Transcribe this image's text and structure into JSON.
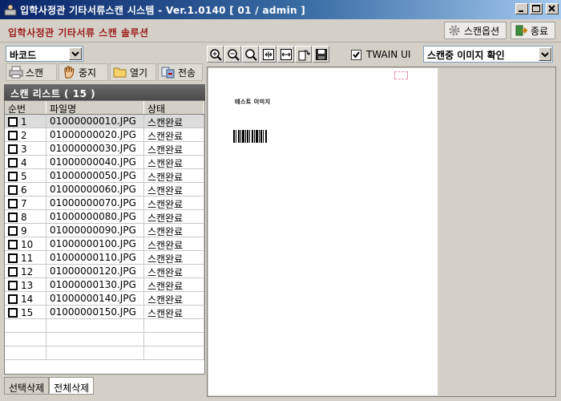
{
  "window": {
    "title": "입학사정관 기타서류스캔 시스템 - Ver.1.0140   [ 01 / admin ]"
  },
  "header": {
    "brand": "입학사정관 기타서류 스캔 솔루션",
    "options_label": "스캔옵션",
    "exit_label": "종료"
  },
  "left": {
    "barcode_select": "바코드",
    "buttons": {
      "scan": "스캔",
      "stop": "중지",
      "open": "열기",
      "send": "전송"
    },
    "list_title": "스캔 리스트 ( 15 )",
    "columns": [
      "순번",
      "파일명",
      "상태"
    ],
    "rows": [
      {
        "no": "1",
        "file": "01000000010.JPG",
        "status": "스캔완료"
      },
      {
        "no": "2",
        "file": "01000000020.JPG",
        "status": "스캔완료"
      },
      {
        "no": "3",
        "file": "01000000030.JPG",
        "status": "스캔완료"
      },
      {
        "no": "4",
        "file": "01000000040.JPG",
        "status": "스캔완료"
      },
      {
        "no": "5",
        "file": "01000000050.JPG",
        "status": "스캔완료"
      },
      {
        "no": "6",
        "file": "01000000060.JPG",
        "status": "스캔완료"
      },
      {
        "no": "7",
        "file": "01000000070.JPG",
        "status": "스캔완료"
      },
      {
        "no": "8",
        "file": "01000000080.JPG",
        "status": "스캔완료"
      },
      {
        "no": "9",
        "file": "01000000090.JPG",
        "status": "스캔완료"
      },
      {
        "no": "10",
        "file": "01000000100.JPG",
        "status": "스캔완료"
      },
      {
        "no": "11",
        "file": "01000000110.JPG",
        "status": "스캔완료"
      },
      {
        "no": "12",
        "file": "01000000120.JPG",
        "status": "스캔완료"
      },
      {
        "no": "13",
        "file": "01000000130.JPG",
        "status": "스캔완료"
      },
      {
        "no": "14",
        "file": "01000000140.JPG",
        "status": "스캔완료"
      },
      {
        "no": "15",
        "file": "01000000150.JPG",
        "status": "스캔완료"
      }
    ],
    "tabs": [
      "선택삭제",
      "전체삭제"
    ]
  },
  "right": {
    "twain_label": "TWAIN UI",
    "twain_checked": true,
    "view_combo": "스캔중 이미지 확인",
    "document_text": "테스트 이미지"
  },
  "colors": {
    "title_gradient_start": "#0a246a",
    "brand_text": "#9b1b1b",
    "list_header": "#4a4a4a"
  }
}
